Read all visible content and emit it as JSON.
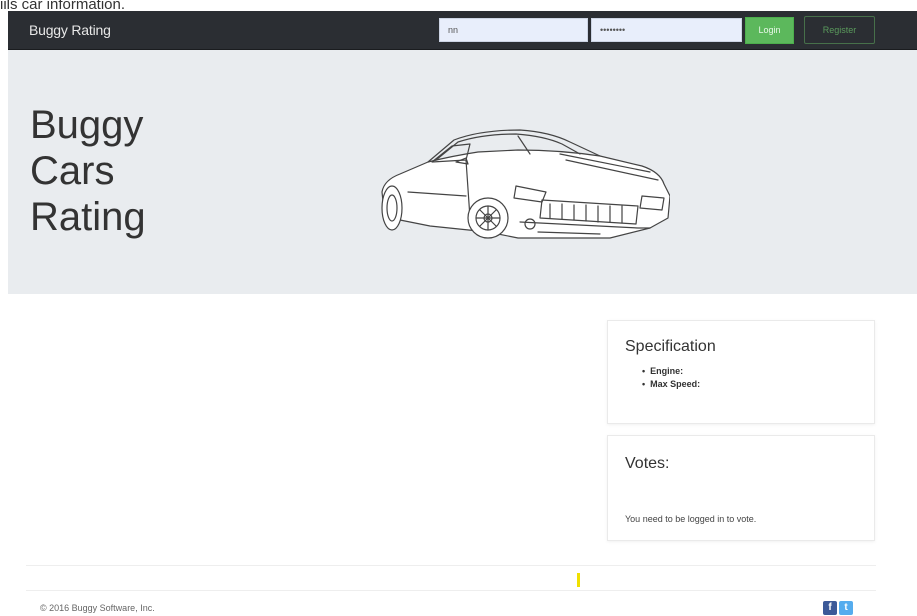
{
  "top_clip_text": "iils car information.",
  "navbar": {
    "brand": "Buggy Rating",
    "login_value": "nn",
    "password_value": "••••••••",
    "login_button": "Login",
    "register_button": "Register"
  },
  "hero": {
    "title_lines": [
      "Buggy",
      "Cars",
      "Rating"
    ]
  },
  "specification": {
    "title": "Specification",
    "items": [
      "Engine:",
      "Max Speed:"
    ]
  },
  "votes": {
    "title": "Votes:",
    "message": "You need to be logged in to vote."
  },
  "footer": {
    "copyright": "© 2016 Buggy Software, Inc.",
    "facebook_glyph": "f",
    "twitter_glyph": "t"
  },
  "colors": {
    "navbar": "#2b2e33",
    "login_green": "#5cb85c",
    "jumbotron": "#e9ecef"
  },
  "icons": [
    "car-illustration",
    "facebook-icon",
    "twitter-icon"
  ]
}
